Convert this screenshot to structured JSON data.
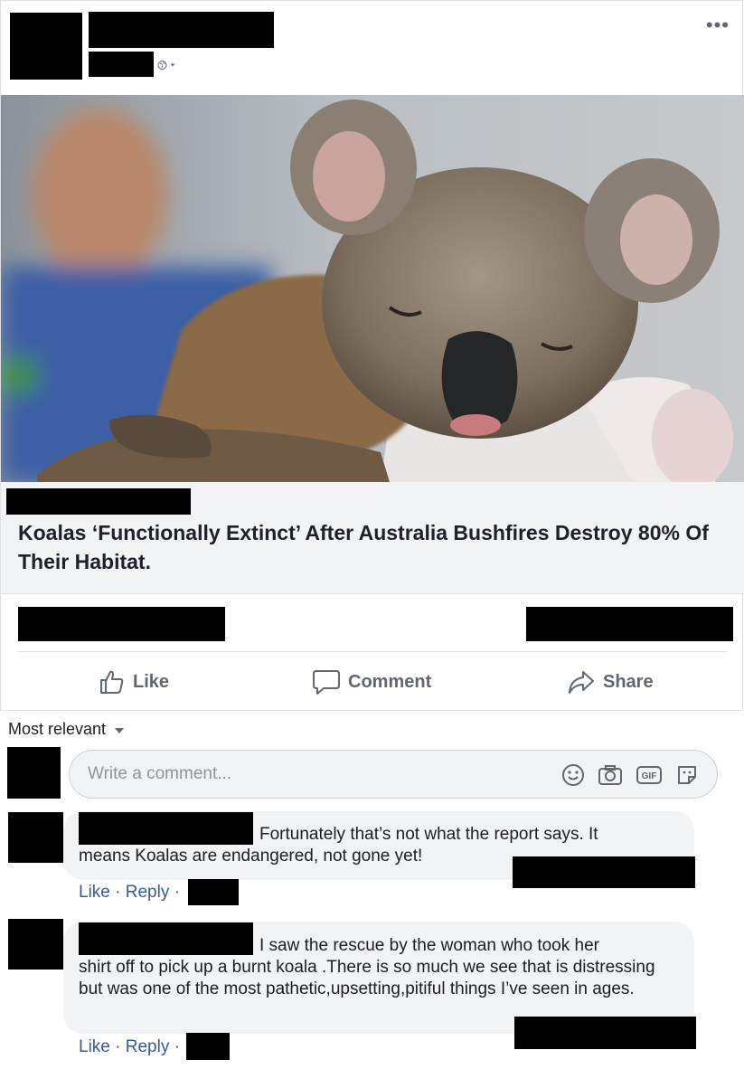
{
  "post": {
    "more_label": "•••",
    "headline": "Koalas ‘Functionally Extinct’ After Australia Bushfires Destroy 80% Of Their Habitat."
  },
  "actions": {
    "like": "Like",
    "comment": "Comment",
    "share": "Share"
  },
  "comments_section": {
    "sort_label": "Most relevant",
    "input_placeholder": "Write a comment...",
    "input_icons": [
      "smiley-icon",
      "camera-icon",
      "gif-icon",
      "sticker-icon"
    ]
  },
  "comments": [
    {
      "text_line1": "Fortunately that’s not what the report says. It",
      "text_rest": "means Koalas are endangered, not gone yet!",
      "like": "Like",
      "reply": "Reply",
      "sep": "·"
    },
    {
      "text_line1": "I saw the rescue by the woman who took her",
      "text_rest": "shirt off to pick up a burnt koala .There is so much we see that is distressing but was one of the most pathetic,upsetting,pitiful things I’ve seen in ages.",
      "like": "Like",
      "reply": "Reply",
      "sep": "·"
    }
  ],
  "colors": {
    "link_blue": "#385898",
    "action_grey": "#606770",
    "bubble_bg": "#f2f3f5"
  }
}
